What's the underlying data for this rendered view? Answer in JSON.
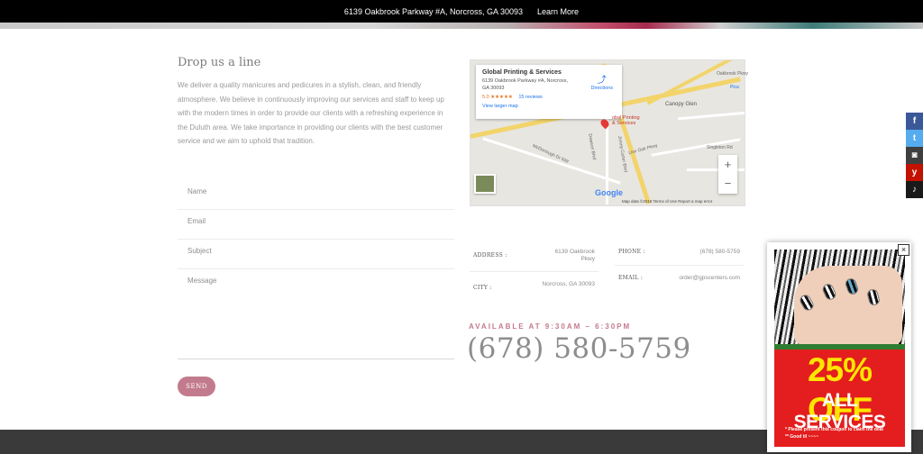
{
  "topbar": {
    "address": "6139 Oakbrook Parkway #A, Norcross, GA 30093",
    "learn_more": "Learn More"
  },
  "contact": {
    "heading": "Drop us a line",
    "about": "We deliver a quality manicures and pedicures in a stylish, clean, and friendly atmosphere. We believe in continuously improving our services and staff to keep up with the modern times in order to provide our clients with a refreshing experience in the Duluth area. We take importance in providing our clients with the best customer service and we aim to uphold that tradition."
  },
  "form": {
    "name_placeholder": "Name",
    "email_placeholder": "Email",
    "subject_placeholder": "Subject",
    "message_placeholder": "Message",
    "send_label": "SEND"
  },
  "map": {
    "place_name": "Global Printing & Services",
    "place_address": "6139 Oakbrook Parkway #A, Norcross, GA 30093",
    "rating": "5.0",
    "stars": "★★★★★",
    "reviews": "15 reviews",
    "view_larger": "View larger map",
    "directions": "Directions",
    "pin_label_1": "obal Printing",
    "pin_label_2": "& Services",
    "zoom_in": "+",
    "zoom_out": "−",
    "google": "Google",
    "footer": "Map data ©2019    Terms of Use    Report a map error",
    "labels": {
      "canopy": "Canopy Glen",
      "mcdonough": "McDonough Dr NW",
      "oakbrook_pkwy": "Oakbrook Pkwy",
      "jimmy_carter": "Jimmy Carter Blvd",
      "singleton": "Singleton Rd",
      "live_oak": "Live Oak Pkwy",
      "oakbrook": "Oakbrook Pkwy",
      "pica": "Pica",
      "dawson": "Dawson Blvd"
    }
  },
  "info": {
    "address_label": "ADDRESS :",
    "address_value": "6139 Oakbrook Pkwy",
    "city_label": "CITY :",
    "city_value": "Norcross, GA 30093",
    "phone_label": "PHONE :",
    "phone_value": "(678) 580-5759",
    "email_label": "EMAIL :",
    "email_value": "order@gpscenters.com"
  },
  "availability": {
    "hours": "AVAILABLE AT 9:30AM – 6:30PM",
    "phone": "(678) 580-5759"
  },
  "social": {
    "facebook": "f",
    "twitter": "t",
    "instagram": "◙",
    "yelp": "y",
    "bell": "♪"
  },
  "popup": {
    "close": "×",
    "offer": "25% OFF",
    "services": "ALL SERVICES",
    "note_1": "* Please present this coupon to claim the deal",
    "note_2": "** Good til ~~~~"
  }
}
